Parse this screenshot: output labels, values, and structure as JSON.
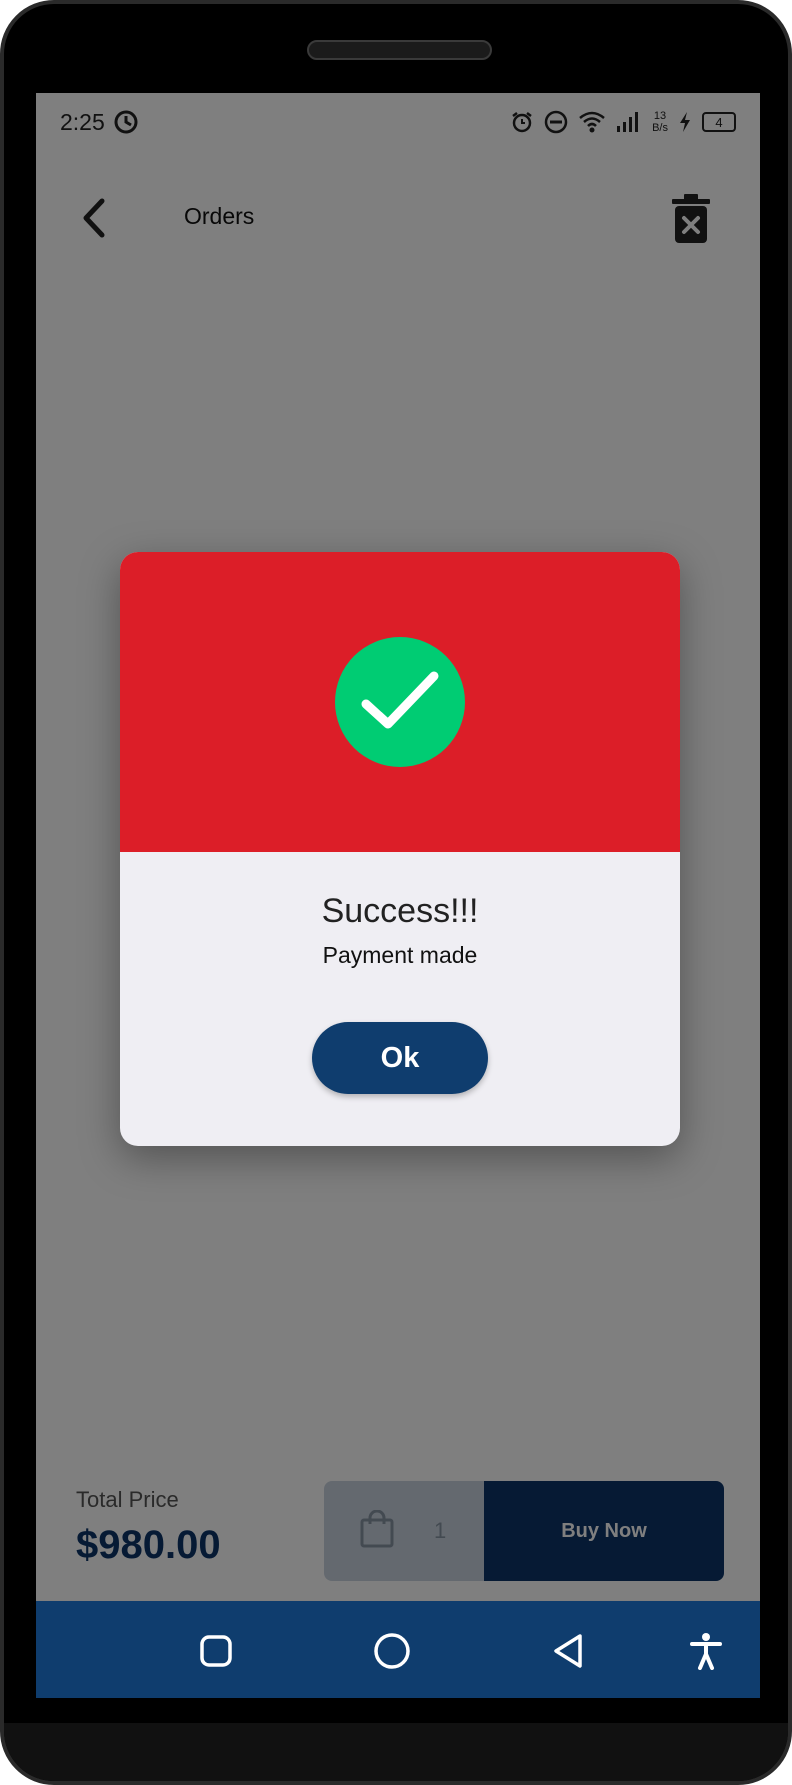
{
  "status_bar": {
    "time": "2:25",
    "net_speed_value": "13",
    "net_speed_unit": "B/s",
    "battery_level": "4"
  },
  "app_bar": {
    "title": "Orders"
  },
  "dialog": {
    "title": "Success!!!",
    "message": "Payment made",
    "ok_label": "Ok"
  },
  "bottom_bar": {
    "total_label": "Total Price",
    "total_value": "$980.00",
    "quantity": "1",
    "buy_now_label": "Buy Now"
  },
  "colors": {
    "primary": "#0f3d6e",
    "header_red": "#dc1e28",
    "success_green": "#00cc73"
  }
}
